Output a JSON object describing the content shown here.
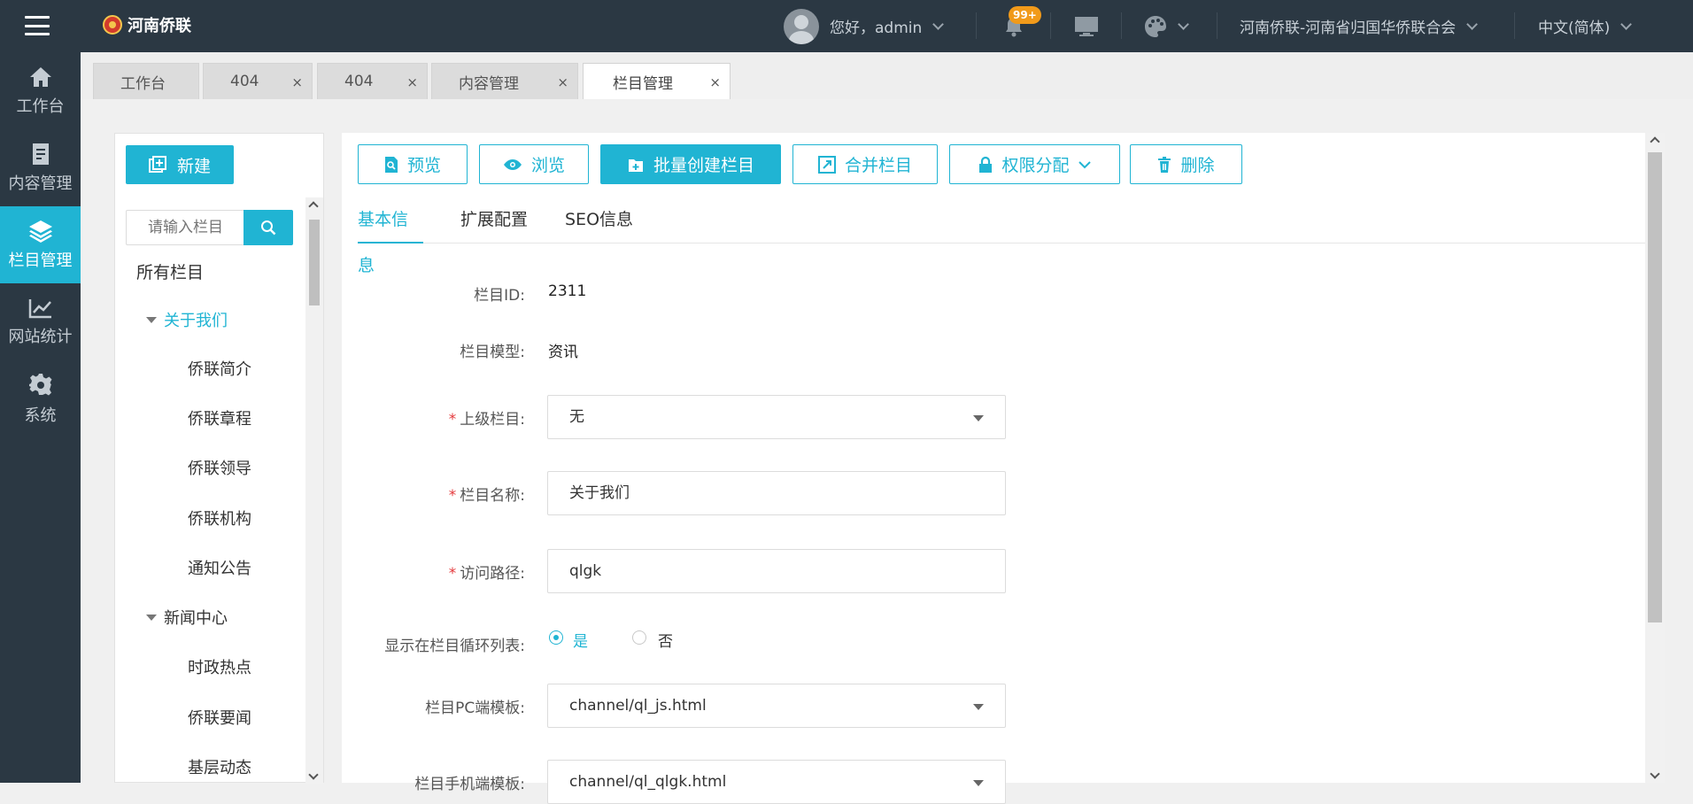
{
  "header": {
    "logo_text": "河南侨联",
    "greeting": "您好，admin",
    "notification_count": "99+",
    "site_name": "河南侨联-河南省归国华侨联合会",
    "language": "中文(简体)"
  },
  "sidebar": {
    "items": [
      {
        "label": "工作台",
        "icon": "home-icon"
      },
      {
        "label": "内容管理",
        "icon": "document-icon"
      },
      {
        "label": "栏目管理",
        "icon": "layers-icon",
        "active": true
      },
      {
        "label": "网站统计",
        "icon": "chart-line-icon"
      },
      {
        "label": "系统",
        "icon": "gear-icon"
      }
    ]
  },
  "tabs": [
    {
      "label": "工作台",
      "closable": false
    },
    {
      "label": "404",
      "closable": true
    },
    {
      "label": "404",
      "closable": true
    },
    {
      "label": "内容管理",
      "closable": true
    },
    {
      "label": "栏目管理",
      "closable": true,
      "active": true
    }
  ],
  "tab_close_glyph": "×",
  "left_panel": {
    "new_button": "新建",
    "search_placeholder": "请输入栏目",
    "tree_root": "所有栏目",
    "nodes": [
      {
        "label": "关于我们",
        "level": 1,
        "expanded": true,
        "selected": true
      },
      {
        "label": "侨联简介",
        "level": 2
      },
      {
        "label": "侨联章程",
        "level": 2
      },
      {
        "label": "侨联领导",
        "level": 2
      },
      {
        "label": "侨联机构",
        "level": 2
      },
      {
        "label": "通知公告",
        "level": 2
      },
      {
        "label": "新闻中心",
        "level": 1,
        "expanded": true
      },
      {
        "label": "时政热点",
        "level": 2
      },
      {
        "label": "侨联要闻",
        "level": 2
      },
      {
        "label": "基层动态",
        "level": 2
      }
    ]
  },
  "toolbar": {
    "preview": "预览",
    "browse": "浏览",
    "batch_create": "批量创建栏目",
    "merge": "合并栏目",
    "permissions": "权限分配",
    "delete": "删除"
  },
  "form_tabs": [
    "基本信息",
    "扩展配置",
    "SEO信息"
  ],
  "form": {
    "id_label": "栏目ID:",
    "id_value": "2311",
    "model_label": "栏目模型:",
    "model_value": "资讯",
    "parent_label": "上级栏目:",
    "parent_value": "无",
    "name_label": "栏目名称:",
    "name_value": "关于我们",
    "path_label": "访问路径:",
    "path_value": "qlgk",
    "show_label": "显示在栏目循环列表:",
    "show_yes": "是",
    "show_no": "否",
    "show_value": "是",
    "pc_template_label": "栏目PC端模板:",
    "pc_template_value": "channel/ql_js.html",
    "mobile_template_label": "栏目手机端模板:",
    "mobile_template_value": "channel/ql_qlgk.html"
  },
  "colors": {
    "accent": "#20b4d3",
    "header_bg": "#2b3843",
    "badge": "#f19a1a",
    "required": "#e4393c"
  }
}
